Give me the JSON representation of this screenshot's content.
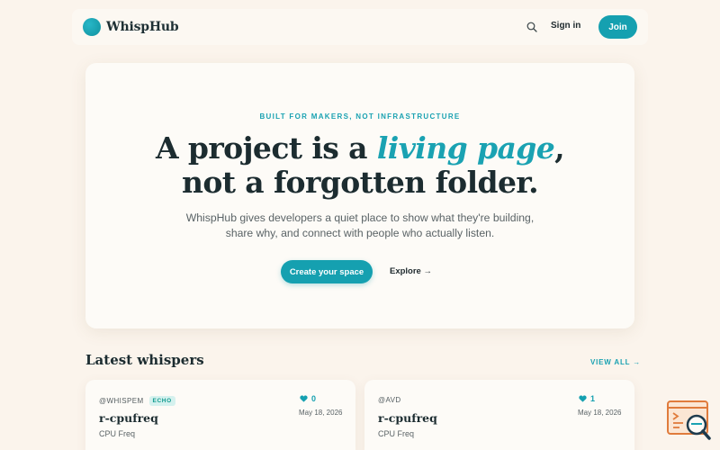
{
  "brand": {
    "name": "WhispHub"
  },
  "nav": {
    "signin": "Sign in",
    "join": "Join"
  },
  "hero": {
    "eyebrow": "BUILT FOR MAKERS, NOT INFRASTRUCTURE",
    "headline_1": "A project is a ",
    "headline_accent": "living page",
    "headline_2": ",",
    "headline_3": "not a forgotten folder.",
    "sub_1": "WhispHub gives developers a quiet place to show what they're building,",
    "sub_2": "share why, and connect with people who actually listen.",
    "cta_primary": "Create your space",
    "cta_secondary": "Explore →"
  },
  "latest": {
    "title": "Latest whispers",
    "view_all": "VIEW ALL →",
    "cards": [
      {
        "user": "@WHISPEM",
        "tag": "ECHO",
        "likes": "0",
        "date": "May 18, 2026",
        "title": "r-cpufreq",
        "subtitle": "CPU Freq"
      },
      {
        "user": "@AVD",
        "tag": "",
        "likes": "1",
        "date": "May 18, 2026",
        "title": "r-cpufreq",
        "subtitle": "CPU Freq"
      }
    ]
  },
  "colors": {
    "accent": "#15a0b0",
    "background": "#fbf4ec",
    "card": "#fdfbf7"
  },
  "icons": {
    "search": "search-icon",
    "heart": "heart-icon",
    "brand": "brand-logo-icon",
    "corner": "log-search-icon"
  }
}
